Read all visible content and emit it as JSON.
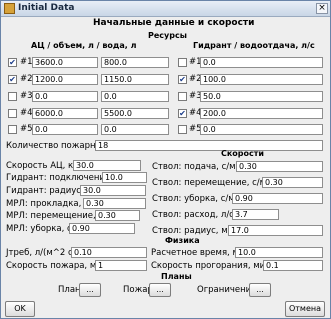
{
  "window": {
    "title": "Initial Data"
  },
  "heading": "Начальные данные и скорости",
  "resources": {
    "title": "Ресурсы",
    "left_header": "АЦ / объем, л / вода, л",
    "right_header": "Гидрант / водоотдача, л/с",
    "left_rows": [
      {
        "label": "#1",
        "checked": true,
        "check": "✔",
        "volume": "3600.0",
        "water": "800.0"
      },
      {
        "label": "#2",
        "checked": true,
        "check": "✔",
        "volume": "1200.0",
        "water": "1150.0"
      },
      {
        "label": "#3",
        "checked": false,
        "check": "",
        "volume": "0.0",
        "water": "0.0"
      },
      {
        "label": "#4",
        "checked": false,
        "check": "",
        "volume": "6000.0",
        "water": "5500.0"
      },
      {
        "label": "#5",
        "checked": false,
        "check": "",
        "volume": "0.0",
        "water": "0.0"
      }
    ],
    "right_rows": [
      {
        "label": "#1",
        "checked": false,
        "check": "",
        "flow": "0.0"
      },
      {
        "label": "#2",
        "checked": true,
        "check": "✔",
        "flow": "100.0"
      },
      {
        "label": "#3",
        "checked": false,
        "check": "",
        "flow": "50.0"
      },
      {
        "label": "#4",
        "checked": true,
        "check": "✔",
        "flow": "200.0"
      },
      {
        "label": "#5",
        "checked": false,
        "check": "",
        "flow": "0.0"
      }
    ]
  },
  "firefighters": {
    "label": "Количество пожарных",
    "value": "18"
  },
  "speeds": {
    "title": "Скорости",
    "left": [
      {
        "label": "Скорость АЦ, км/ч",
        "value": "30.0"
      },
      {
        "label": "Гидрант: подключение, с",
        "value": "10.0"
      },
      {
        "label": "Гидрант: радиус, м",
        "value": "30.0"
      },
      {
        "label": "МРЛ: прокладка, с/м",
        "value": "0.30"
      },
      {
        "label": "МРЛ: перемещение, с/м",
        "value": "0.30"
      },
      {
        "label": "МРЛ: уборка, с/м",
        "value": "0.90"
      }
    ],
    "right": [
      {
        "label": "Ствол: подача, с/м",
        "value": "0.30"
      },
      {
        "label": "Ствол: перемещение, с/м",
        "value": "0.30"
      },
      {
        "label": "Ствол: уборка, с/м",
        "value": "0.90"
      },
      {
        "label": "Ствол: расход, л/с",
        "value": "3.7"
      },
      {
        "label": "Ствол: радиус, м",
        "value": "17.0"
      }
    ]
  },
  "physics": {
    "title": "Физика",
    "rows": [
      {
        "label": "Jтреб, л/(м^2 с)",
        "value": "0.10"
      },
      {
        "label": "Расчетное время, мин",
        "value": "10.0"
      },
      {
        "label": "Скорость пожара, м/мин",
        "value": "1"
      },
      {
        "label": "Скорость прогорания, мин/(см)",
        "value": "0.1"
      }
    ]
  },
  "plans": {
    "title": "Планы",
    "items": [
      {
        "label": "План",
        "button": "..."
      },
      {
        "label": "Пожар",
        "button": "..."
      },
      {
        "label": "Ограничения",
        "button": "..."
      }
    ]
  },
  "buttons": {
    "ok": "OK",
    "cancel": "Отмена"
  }
}
